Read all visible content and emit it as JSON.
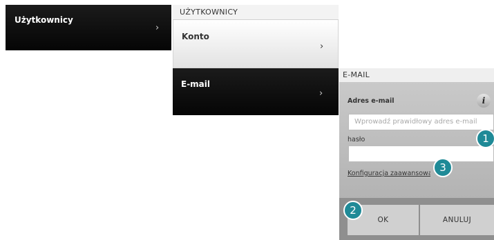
{
  "panel_users": {
    "label": "Użytkownicy",
    "chevron": "›"
  },
  "panel_users_menu": {
    "header": "UŻYTKOWNICY",
    "items": [
      {
        "label": "Konto",
        "chevron": "›"
      },
      {
        "label": "E-mail",
        "chevron": "›"
      }
    ]
  },
  "panel_email": {
    "header": "E-MAIL",
    "address_label": "Adres e-mail",
    "info_icon": "i",
    "email_placeholder": "Wprowadź prawidłowy adres e-mail",
    "password_label": "hasło",
    "advanced_link": "Konfiguracja zaawansowana",
    "ok_label": "OK",
    "cancel_label": "ANULUJ"
  },
  "badges": [
    "1",
    "2",
    "3"
  ],
  "colors": {
    "badge": "#1f8a97",
    "dark_panel": "#0a0a0a",
    "form_bg": "#bdbdbd"
  }
}
